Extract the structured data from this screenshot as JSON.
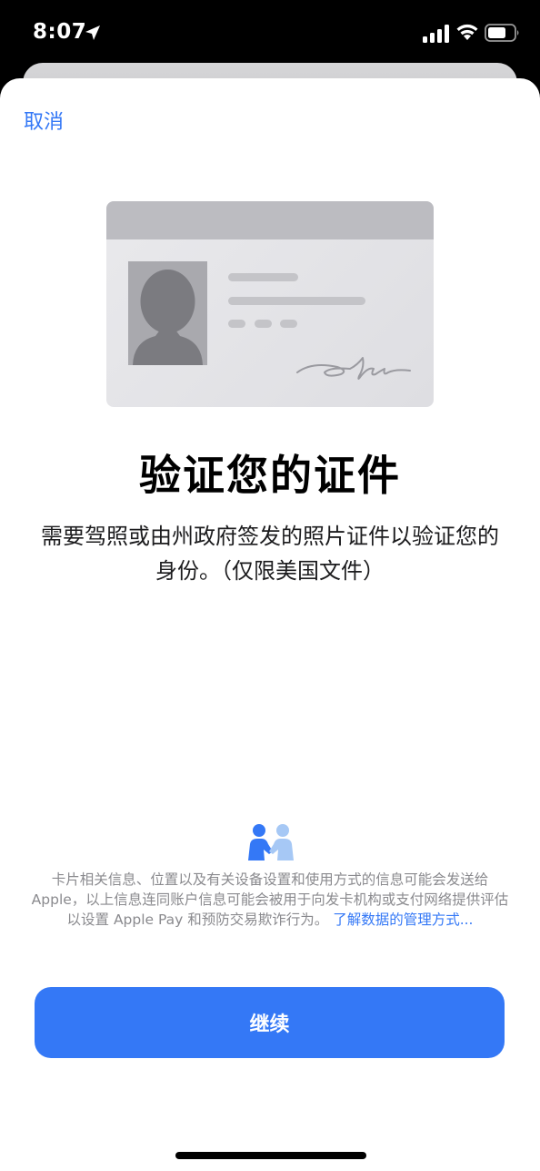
{
  "status_bar": {
    "time": "8:07",
    "icons": [
      "location-arrow-icon",
      "cellular-signal-icon",
      "wifi-icon",
      "battery-icon"
    ]
  },
  "sheet": {
    "cancel_label": "取消",
    "title": "验证您的证件",
    "description": "需要驾照或由州政府签发的照片证件以验证您的身份。（仅限美国文件）",
    "illustration": "id-card-illustration"
  },
  "privacy": {
    "icon": "handshake-privacy-icon",
    "text": "卡片相关信息、位置以及有关设备设置和使用方式的信息可能会发送给 Apple，以上信息连同账户信息可能会被用于向发卡机构或支付网络提供评估以设置 Apple Pay 和预防交易欺诈行为。",
    "link_label": "了解数据的管理方式..."
  },
  "footer": {
    "continue_label": "继续"
  },
  "colors": {
    "accent": "#3478f6",
    "background": "#ffffff",
    "status_bar_bg": "#000000"
  }
}
